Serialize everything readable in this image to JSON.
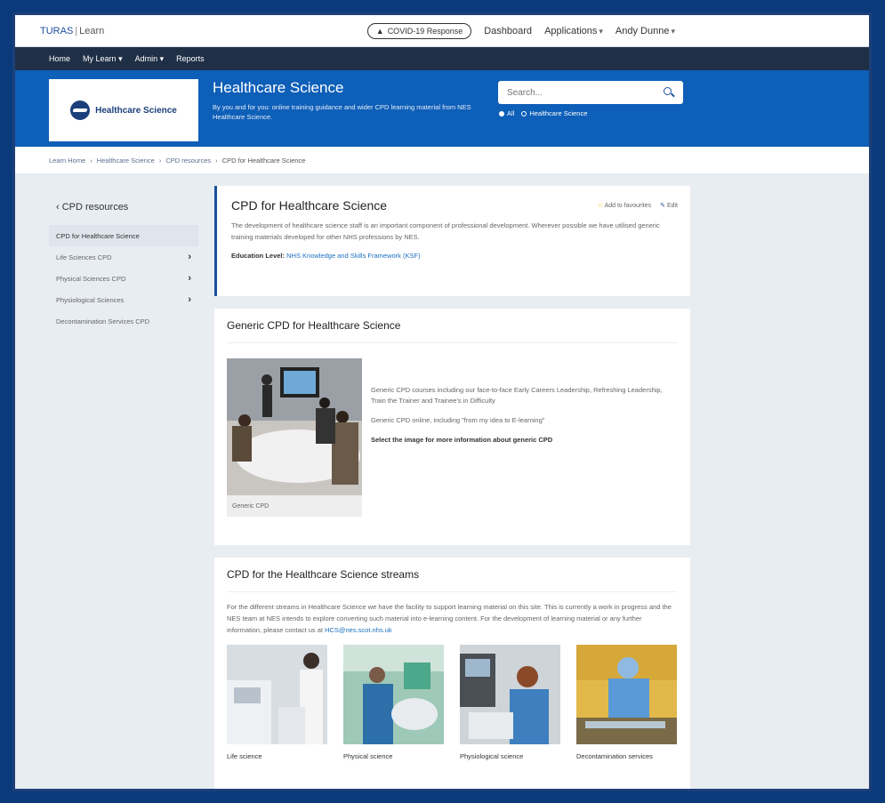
{
  "topbar": {
    "brand": "TURAS",
    "brand_sub": "Learn",
    "covid_button": "COVID-19 Response",
    "dashboard": "Dashboard",
    "applications": "Applications",
    "user": "Andy Dunne"
  },
  "mainnav": {
    "home": "Home",
    "mylearn": "My Learn",
    "admin": "Admin",
    "reports": "Reports"
  },
  "hero": {
    "logo_text": "Healthcare Science",
    "title": "Healthcare Science",
    "subtitle": "By you and for you: online training guidance and wider CPD learning material from NES Healthcare Science.",
    "search_placeholder": "Search...",
    "scope_all": "All",
    "scope_site": "Healthcare Science"
  },
  "breadcrumb": [
    "Learn Home",
    "Healthcare Science",
    "CPD resources",
    "CPD for Healthcare Science"
  ],
  "sidebar": {
    "back": "CPD resources",
    "items": [
      {
        "label": "CPD for Healthcare Science"
      },
      {
        "label": "Life Sciences CPD"
      },
      {
        "label": "Physical Sciences CPD"
      },
      {
        "label": "Physiological Sciences"
      },
      {
        "label": "Decontamination Services CPD"
      }
    ]
  },
  "page": {
    "title": "CPD for Healthcare Science",
    "add_fav": "Add to favourites",
    "edit": "Edit",
    "description": "The development of healthcare science staff is an important component of professional development. Wherever possible we have utilised generic training materials developed for other NHS professions by NES.",
    "edu_label": "Education Level:",
    "edu_value": "NHS Knowledge and Skills Framework (KSF)"
  },
  "generic": {
    "title": "Generic CPD for Healthcare Science",
    "caption": "Generic CPD",
    "text1": "Generic CPD courses including our face-to-face Early Careers Leadership, Refreshing Leadership, Train the Trainer and Trainee's in Difficulty",
    "text2": "Generic CPD online, including \"from my idea to E-learning\"",
    "text3": "Select the image for more information about generic CPD"
  },
  "streams": {
    "title": "CPD for the Healthcare Science streams",
    "text": "For the different streams in Healthcare Science we have the facility to support learning material on this site. This is currently a work in progress and the NES team at NES intends to explore converting such material into e-learning content. For the development of learning material or any further information, please contact us at ",
    "email": "HCS@nes.scot.nhs.uk",
    "items": [
      {
        "label": "Life science"
      },
      {
        "label": "Physical science"
      },
      {
        "label": "Physiological science"
      },
      {
        "label": "Decontamination services"
      }
    ]
  }
}
